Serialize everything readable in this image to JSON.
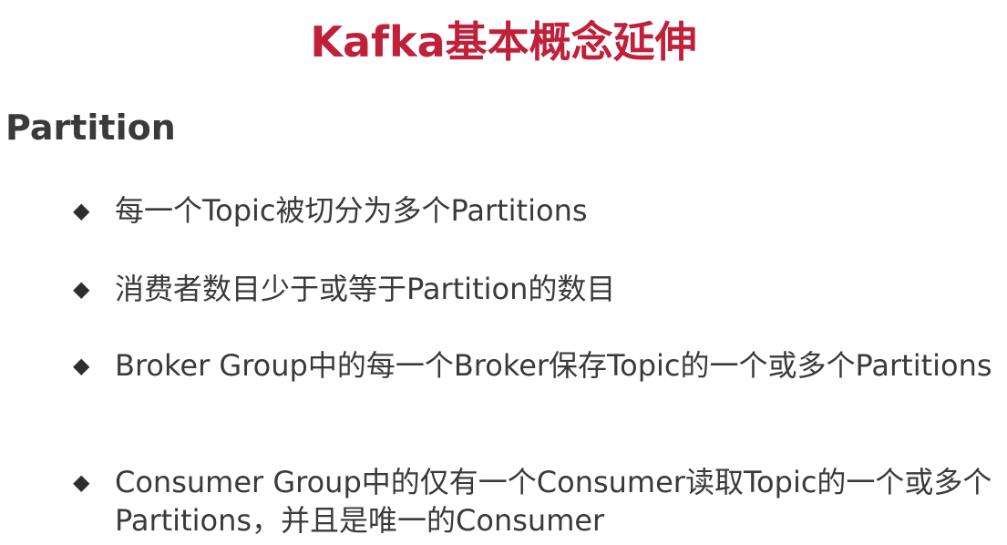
{
  "slide": {
    "title": "Kafka基本概念延伸",
    "section_heading": "Partition",
    "bullet_marker": "◆",
    "bullets": [
      {
        "text": "每一个Topic被切分为多个Partitions"
      },
      {
        "text": "消费者数目少于或等于Partition的数目"
      },
      {
        "text": "Broker Group中的每一个Broker保存Topic的一个或多个Partitions"
      },
      {
        "text": "Consumer Group中的仅有一个Consumer读取Topic的一个或多个Partitions，并且是唯一的Consumer"
      }
    ],
    "colors": {
      "title": "#c0203a",
      "text": "#3a3a3a",
      "background": "#ffffff"
    }
  }
}
